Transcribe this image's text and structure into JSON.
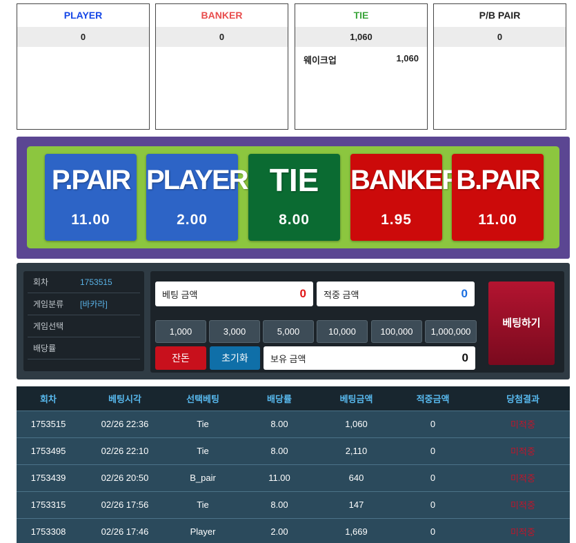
{
  "summary": [
    {
      "title": "PLAYER",
      "color": "#1446e6",
      "total": "0",
      "items": []
    },
    {
      "title": "BANKER",
      "color": "#e84c4c",
      "total": "0",
      "items": []
    },
    {
      "title": "TIE",
      "color": "#3aa43a",
      "total": "1,060",
      "items": [
        {
          "name": "웨이크업",
          "amount": "1,060"
        }
      ]
    },
    {
      "title": "P/B PAIR",
      "color": "#222222",
      "total": "0",
      "items": []
    }
  ],
  "board": {
    "tiles": [
      {
        "name": "P.PAIR",
        "odds": "11.00",
        "color": "#2d64c6"
      },
      {
        "name": "PLAYER",
        "odds": "2.00",
        "color": "#2d64c6"
      },
      {
        "name": "TIE",
        "odds": "8.00",
        "color": "#0b6b32"
      },
      {
        "name": "BANKER",
        "odds": "1.95",
        "color": "#cc0a0a"
      },
      {
        "name": "B.PAIR",
        "odds": "11.00",
        "color": "#cc0a0a"
      }
    ]
  },
  "info": {
    "round_label": "회차",
    "round_value": "1753515",
    "type_label": "게임분류",
    "type_value": "[바카라]",
    "pick_label": "게임선택",
    "pick_value": "",
    "odds_label": "배당률",
    "odds_value": ""
  },
  "bet": {
    "amount_label": "베팅 금액",
    "amount_value": "0",
    "win_label": "적중 금액",
    "win_value": "0",
    "balance_label": "보유 금액",
    "balance_value": "0",
    "chips": [
      "1,000",
      "3,000",
      "5,000",
      "10,000",
      "100,000",
      "1,000,000"
    ],
    "change_label": "잔돈",
    "reset_label": "초기화",
    "submit_label": "베팅하기"
  },
  "history": {
    "headers": [
      "회차",
      "베팅시각",
      "선택베팅",
      "배당률",
      "베팅금액",
      "적중금액",
      "당첨결과"
    ],
    "rows": [
      [
        "1753515",
        "02/26 22:36",
        "Tie",
        "8.00",
        "1,060",
        "0",
        "미적중"
      ],
      [
        "1753495",
        "02/26 22:10",
        "Tie",
        "8.00",
        "2,110",
        "0",
        "미적중"
      ],
      [
        "1753439",
        "02/26 20:50",
        "B_pair",
        "11.00",
        "640",
        "0",
        "미적중"
      ],
      [
        "1753315",
        "02/26 17:56",
        "Tie",
        "8.00",
        "147",
        "0",
        "미적중"
      ],
      [
        "1753308",
        "02/26 17:46",
        "Player",
        "2.00",
        "1,669",
        "0",
        "미적중"
      ]
    ]
  }
}
